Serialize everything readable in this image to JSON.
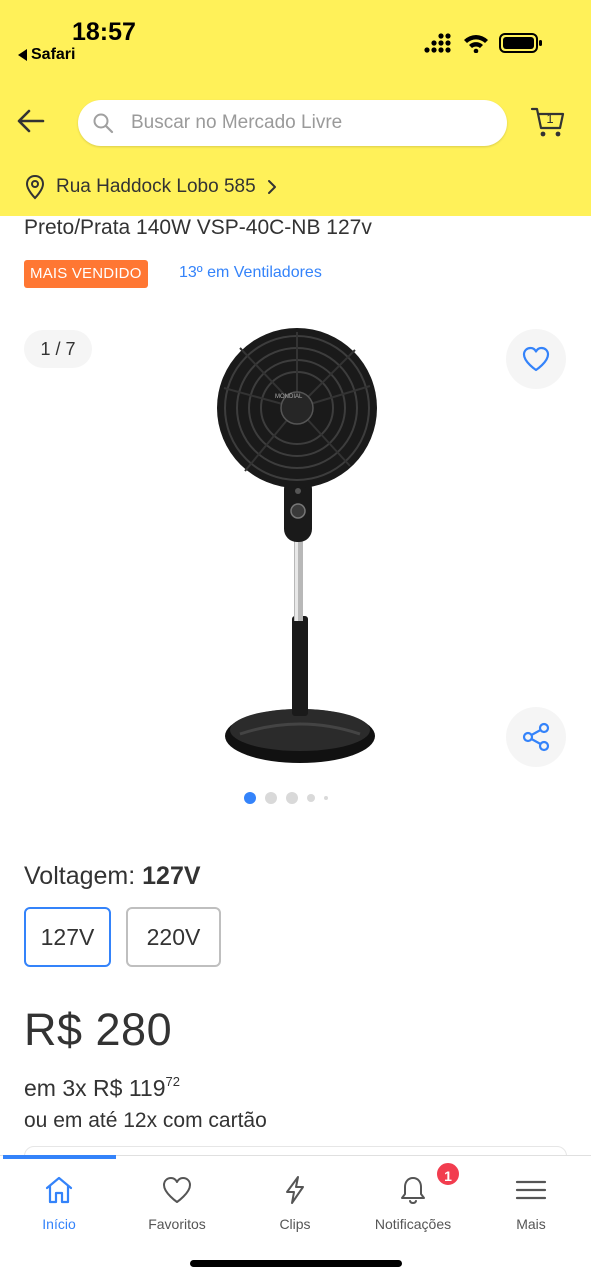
{
  "status_bar": {
    "time": "18:57",
    "back_app": "Safari"
  },
  "header": {
    "search_placeholder": "Buscar no Mercado Livre",
    "cart_count": "1",
    "address": "Rua Haddock Lobo 585",
    "brand_color": "#fff159"
  },
  "product": {
    "title_partial": "Preto/Prata 140W VSP-40C-NB 127v",
    "badge": "MAIS VENDIDO",
    "ranking": "13º em Ventiladores",
    "gallery_counter": "1 / 7",
    "gallery_total": 7,
    "gallery_current": 1,
    "image_brand_text": "MONDIAL"
  },
  "variation": {
    "label": "Voltagem:",
    "selected": "127V",
    "options": [
      "127V",
      "220V"
    ]
  },
  "pricing": {
    "price": "R$ 280",
    "installment_prefix": "em 3x R$ 119",
    "installment_cents": "72",
    "card_text": "ou em até 12x com cartão"
  },
  "tabbar": {
    "items": [
      {
        "label": "Início",
        "icon": "home-icon",
        "active": true
      },
      {
        "label": "Favoritos",
        "icon": "heart-icon"
      },
      {
        "label": "Clips",
        "icon": "lightning-icon"
      },
      {
        "label": "Notificações",
        "icon": "bell-icon"
      },
      {
        "label": "Mais",
        "icon": "menu-icon"
      }
    ],
    "notification_count": "1"
  },
  "colors": {
    "accent": "#3483fa",
    "badge": "#ff7733",
    "notification": "#f23d4f"
  }
}
